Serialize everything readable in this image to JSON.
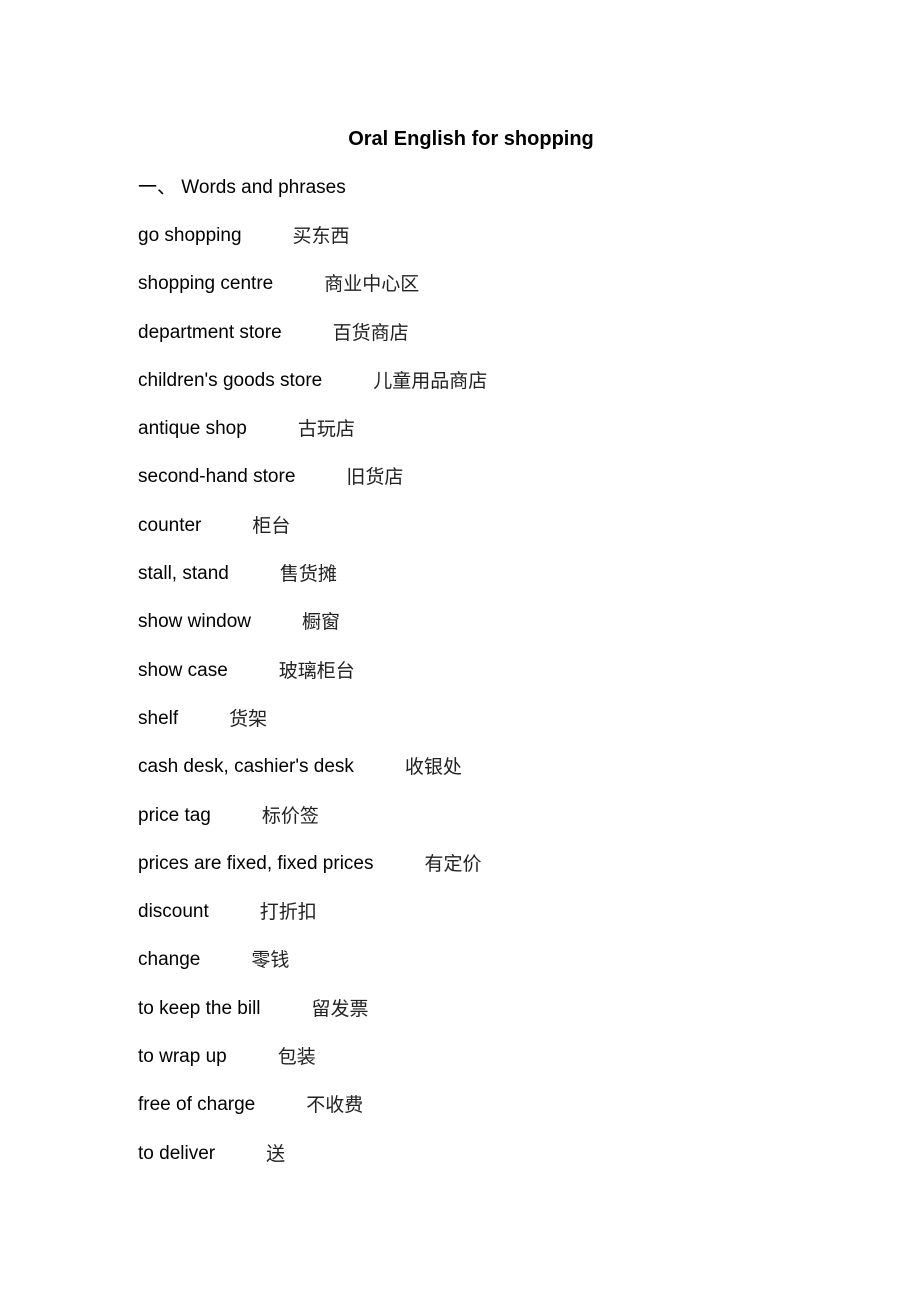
{
  "document": {
    "title": "Oral English for shopping",
    "section": {
      "number": "一、",
      "heading": "Words and phrases"
    },
    "vocabulary": [
      {
        "en": "go shopping",
        "zh": "买东西"
      },
      {
        "en": "shopping centre",
        "zh": "商业中心区"
      },
      {
        "en": "department store",
        "zh": "百货商店"
      },
      {
        "en": "children's goods store",
        "zh": "儿童用品商店"
      },
      {
        "en": "antique shop",
        "zh": "古玩店"
      },
      {
        "en": "second-hand store",
        "zh": "旧货店"
      },
      {
        "en": "counter",
        "zh": "柜台"
      },
      {
        "en": "stall, stand",
        "zh": "售货摊"
      },
      {
        "en": "show window",
        "zh": "橱窗"
      },
      {
        "en": "show case",
        "zh": "玻璃柜台"
      },
      {
        "en": "shelf",
        "zh": "货架"
      },
      {
        "en": "cash desk, cashier's desk",
        "zh": "收银处"
      },
      {
        "en": "price tag",
        "zh": "标价签"
      },
      {
        "en": "prices are fixed, fixed prices",
        "zh": "有定价"
      },
      {
        "en": "discount",
        "zh": "打折扣"
      },
      {
        "en": "change",
        "zh": "零钱"
      },
      {
        "en": "to keep the bill",
        "zh": "留发票"
      },
      {
        "en": "to wrap up",
        "zh": "包装"
      },
      {
        "en": "free of charge",
        "zh": "不收费"
      },
      {
        "en": "to deliver",
        "zh": "送"
      }
    ]
  }
}
